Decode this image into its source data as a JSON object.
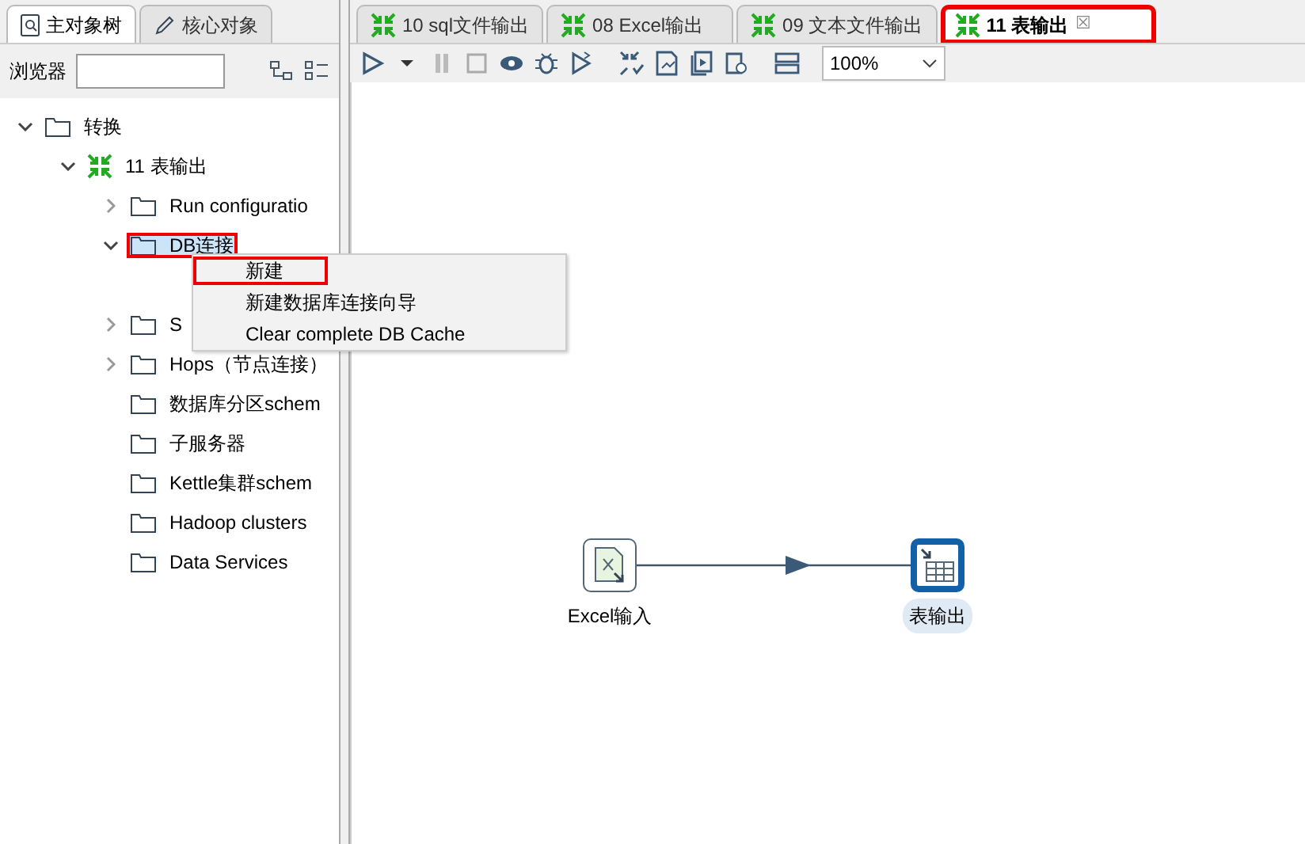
{
  "left_tabs": [
    {
      "label": "主对象树",
      "selected": true
    },
    {
      "label": "核心对象",
      "selected": false
    }
  ],
  "browser": {
    "label": "浏览器"
  },
  "tree": [
    {
      "label": "转换",
      "kind": "folder",
      "expanded": true,
      "children": [
        {
          "label": "11 表输出",
          "kind": "transform",
          "expanded": true,
          "children": [
            {
              "label": "Run configuratio",
              "kind": "folder",
              "expanded": false
            },
            {
              "label": "DB连接",
              "kind": "folder",
              "expanded": true,
              "selected": true,
              "highlighted": true
            },
            {
              "label": "S",
              "kind": "folder",
              "expanded": false
            },
            {
              "label": "Hops（节点连接）",
              "kind": "folder",
              "expanded": false
            },
            {
              "label": "数据库分区schem",
              "kind": "folder"
            },
            {
              "label": "子服务器",
              "kind": "folder"
            },
            {
              "label": "Kettle集群schem",
              "kind": "folder"
            },
            {
              "label": "Hadoop clusters",
              "kind": "folder"
            },
            {
              "label": "Data Services",
              "kind": "folder"
            }
          ]
        }
      ]
    }
  ],
  "context_menu": [
    {
      "label": "新建",
      "highlighted": true
    },
    {
      "label": "新建数据库连接向导",
      "highlighted": false
    },
    {
      "label": "Clear complete DB Cache",
      "highlighted": false
    }
  ],
  "editor_tabs": [
    {
      "label": "10 sql文件输出",
      "selected": false,
      "highlighted": false
    },
    {
      "label": "08 Excel输出",
      "selected": false,
      "highlighted": false
    },
    {
      "label": "09 文本文件输出",
      "selected": false,
      "highlighted": false
    },
    {
      "label": "11 表输出",
      "selected": true,
      "highlighted": true,
      "close": "☒"
    }
  ],
  "zoom": {
    "value": "100%"
  },
  "canvas": {
    "steps": [
      {
        "label": "Excel输入",
        "kind": "excel",
        "selected": false
      },
      {
        "label": "表输出",
        "kind": "table",
        "selected": true
      }
    ]
  }
}
